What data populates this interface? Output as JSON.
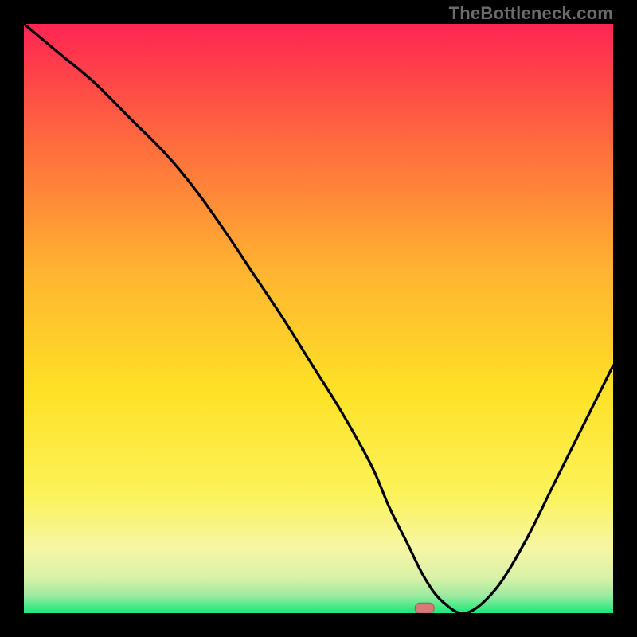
{
  "watermark": "TheBottleneck.com",
  "colors": {
    "page_bg": "#000000",
    "gradient_top": "#fe2552",
    "gradient_mid1": "#ff6a3e",
    "gradient_mid2": "#ffb431",
    "gradient_mid3": "#fee126",
    "gradient_mid4": "#f9f57c",
    "gradient_mid5": "#d9f1a8",
    "gradient_bottom": "#17e879",
    "curve": "#000000",
    "marker_fill": "#d57a74",
    "marker_stroke": "#b0544e"
  },
  "chart_data": {
    "type": "line",
    "title": "",
    "xlabel": "",
    "ylabel": "",
    "xlim": [
      0,
      100
    ],
    "ylim": [
      0,
      100
    ],
    "x": [
      0,
      6,
      12,
      18,
      24,
      29,
      34,
      39,
      44,
      49,
      54,
      59,
      62,
      65,
      68,
      71,
      75,
      80,
      85,
      90,
      95,
      100
    ],
    "values": [
      100,
      95,
      90,
      84,
      78,
      72,
      65,
      57.5,
      50,
      42,
      34,
      25,
      18,
      12,
      6,
      2,
      0,
      4,
      12,
      22,
      32,
      42
    ],
    "marker": {
      "x": 68,
      "y": 0.5
    },
    "note": "x is relative position along the horizontal axis (0–100 left→right); values are relative height (0 at bottom, 100 at top). Values read off the plotted curve against the gradient background; no numeric ticks are visible in the source image so all numbers are proportional estimates."
  }
}
